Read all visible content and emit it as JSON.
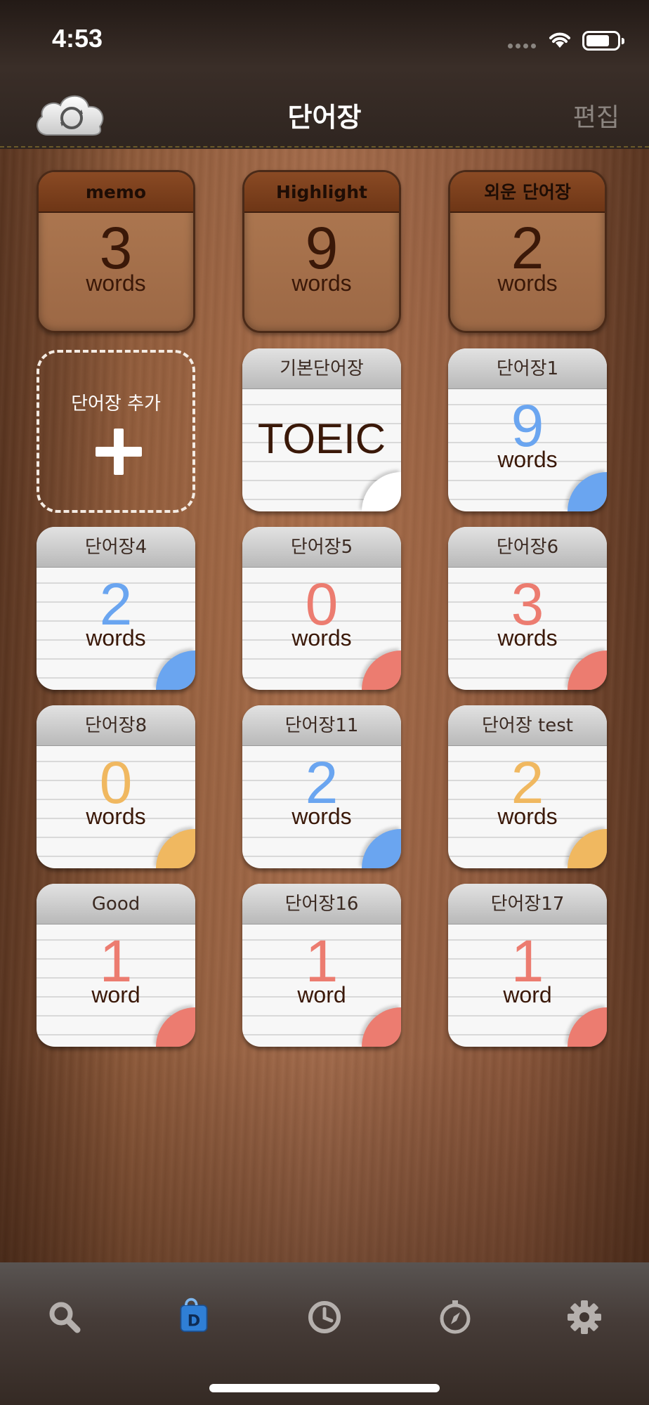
{
  "status": {
    "time": "4:53"
  },
  "nav": {
    "title": "단어장",
    "edit_label": "편집"
  },
  "summary_tiles": [
    {
      "label": "memo",
      "count": "3",
      "unit": "words"
    },
    {
      "label": "Highlight",
      "count": "9",
      "unit": "words"
    },
    {
      "label": "외운 단어장",
      "count": "2",
      "unit": "words"
    }
  ],
  "add_tile": {
    "label": "단어장 추가"
  },
  "wordbooks": [
    {
      "name": "기본단어장",
      "text": "TOEIC"
    },
    {
      "name": "단어장1",
      "count": "9",
      "unit": "words",
      "color": "#6aa5f0"
    },
    {
      "name": "단어장4",
      "count": "2",
      "unit": "words",
      "color": "#6aa5f0"
    },
    {
      "name": "단어장5",
      "count": "0",
      "unit": "words",
      "color": "#ec7c70"
    },
    {
      "name": "단어장6",
      "count": "3",
      "unit": "words",
      "color": "#ec7c70"
    },
    {
      "name": "단어장8",
      "count": "0",
      "unit": "words",
      "color": "#f0b860"
    },
    {
      "name": "단어장11",
      "count": "2",
      "unit": "words",
      "color": "#6aa5f0"
    },
    {
      "name": "단어장 test",
      "count": "2",
      "unit": "words",
      "color": "#f0b860"
    },
    {
      "name": "Good",
      "count": "1",
      "unit": "word",
      "color": "#ec7c70"
    },
    {
      "name": "단어장16",
      "count": "1",
      "unit": "word",
      "color": "#ec7c70"
    },
    {
      "name": "단어장17",
      "count": "1",
      "unit": "word",
      "color": "#ec7c70"
    }
  ],
  "tabbar": {
    "tabs": [
      {
        "icon": "search-icon"
      },
      {
        "icon": "wordbook-icon",
        "selected": true,
        "badge_letter": "D"
      },
      {
        "icon": "history-clock-icon"
      },
      {
        "icon": "compass-icon"
      },
      {
        "icon": "gear-icon"
      }
    ]
  }
}
